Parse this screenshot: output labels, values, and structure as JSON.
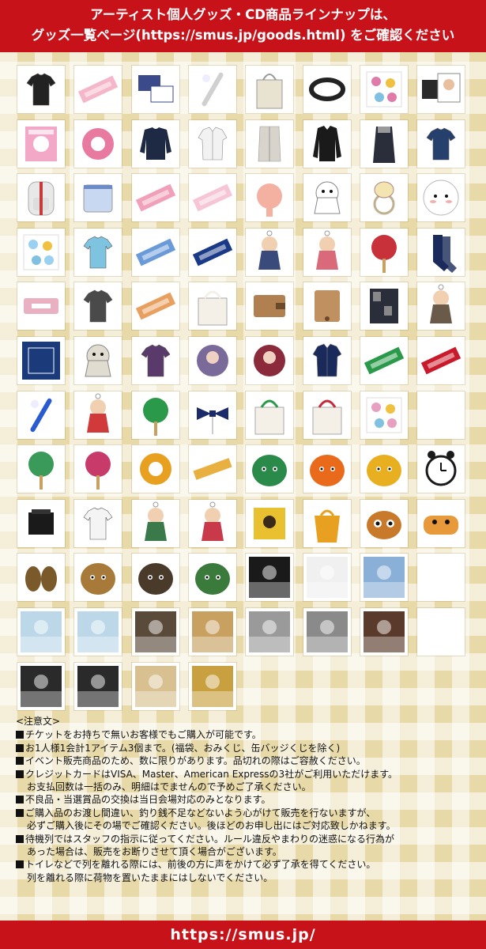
{
  "header": {
    "line1": "アーティスト個人グッズ・CD商品ラインナップは、",
    "line2": "グッズ一覧ページ(https://smus.jp/goods.html) をご確認ください"
  },
  "products": [
    {
      "icon": "tshirt",
      "color": "#222222"
    },
    {
      "icon": "towel",
      "color": "#f4b6c8"
    },
    {
      "icon": "cards",
      "color": "#3a4a8a"
    },
    {
      "icon": "penlight",
      "color": "#d0d0d0"
    },
    {
      "icon": "bag",
      "color": "#e8e2d0"
    },
    {
      "icon": "rubber-band",
      "color": "#222222"
    },
    {
      "icon": "stickers",
      "color": "#e07aa8"
    },
    {
      "icon": "card-set",
      "color": "#2a2a2a"
    },
    {
      "icon": "book",
      "color": "#f4a8c8"
    },
    {
      "icon": "tape",
      "color": "#e87aa0"
    },
    {
      "icon": "sweater",
      "color": "#1e2a44"
    },
    {
      "icon": "shirt",
      "color": "#f2f2f2"
    },
    {
      "icon": "cardigan",
      "color": "#d8d4cc"
    },
    {
      "icon": "jacket",
      "color": "#1a1a1a"
    },
    {
      "icon": "coat",
      "color": "#2a2d3a"
    },
    {
      "icon": "tshirt",
      "color": "#26406e"
    },
    {
      "icon": "backpack",
      "color": "#e8e8e8"
    },
    {
      "icon": "pouch",
      "color": "#c8d8f0"
    },
    {
      "icon": "towel",
      "color": "#f0a0b8"
    },
    {
      "icon": "towel",
      "color": "#f6c6d6"
    },
    {
      "icon": "mirror",
      "color": "#f4b0a0"
    },
    {
      "icon": "mascot",
      "color": "#ffffff"
    },
    {
      "icon": "hair-tie",
      "color": "#c0b090"
    },
    {
      "icon": "cushion",
      "color": "#ffffff"
    },
    {
      "icon": "stickers",
      "color": "#9ad0f0"
    },
    {
      "icon": "tshirt",
      "color": "#7ec4e0"
    },
    {
      "icon": "towel",
      "color": "#6a9ad8"
    },
    {
      "icon": "towel",
      "color": "#1a3a88"
    },
    {
      "icon": "acrylic",
      "color": "#3a4a7a"
    },
    {
      "icon": "acrylic",
      "color": "#d86a7a"
    },
    {
      "icon": "fan",
      "color": "#c8303a"
    },
    {
      "icon": "socks",
      "color": "#1a2a5a"
    },
    {
      "icon": "case",
      "color": "#e8b0c0"
    },
    {
      "icon": "tshirt",
      "color": "#4a4a4a"
    },
    {
      "icon": "towel",
      "color": "#e8a060"
    },
    {
      "icon": "tote",
      "color": "#f4f0e8"
    },
    {
      "icon": "wallet",
      "color": "#b08050"
    },
    {
      "icon": "card-case",
      "color": "#c09060"
    },
    {
      "icon": "notebook",
      "color": "#2a2e3a"
    },
    {
      "icon": "acrylic",
      "color": "#6a5a4a"
    },
    {
      "icon": "bandana",
      "color": "#1a3a7a"
    },
    {
      "icon": "mascot",
      "color": "#e0dcd0"
    },
    {
      "icon": "tshirt",
      "color": "#5a3a6a"
    },
    {
      "icon": "badge",
      "color": "#7a6a9a"
    },
    {
      "icon": "badge",
      "color": "#8a2a3a"
    },
    {
      "icon": "shirt",
      "color": "#1a2a5a"
    },
    {
      "icon": "towel",
      "color": "#2a9a4a"
    },
    {
      "icon": "towel",
      "color": "#c81a2a"
    },
    {
      "icon": "penlight",
      "color": "#2a5ad0"
    },
    {
      "icon": "acrylic",
      "color": "#d03a3a"
    },
    {
      "icon": "fan",
      "color": "#2a9a4a"
    },
    {
      "icon": "ribbon",
      "color": "#1a2a6a"
    },
    {
      "icon": "tote",
      "color": "#2a9a4a"
    },
    {
      "icon": "tote",
      "color": "#c82a3a"
    },
    {
      "icon": "stickers",
      "color": "#e8a0c0"
    },
    {
      "icon": "blank",
      "color": "#ffffff"
    },
    {
      "icon": "fan",
      "color": "#3a9a5a"
    },
    {
      "icon": "fan",
      "color": "#c83a6a"
    },
    {
      "icon": "tape",
      "color": "#e8a020"
    },
    {
      "icon": "ruler",
      "color": "#e8b040"
    },
    {
      "icon": "plush",
      "color": "#2a8a4a"
    },
    {
      "icon": "plush",
      "color": "#e86a1a"
    },
    {
      "icon": "plush",
      "color": "#e8b020"
    },
    {
      "icon": "clock",
      "color": "#1a1a1a"
    },
    {
      "icon": "box",
      "color": "#1a1a1a"
    },
    {
      "icon": "tshirt",
      "color": "#f4f4f4"
    },
    {
      "icon": "acrylic",
      "color": "#3a7a4a"
    },
    {
      "icon": "acrylic",
      "color": "#c83a4a"
    },
    {
      "icon": "blanket",
      "color": "#e8c030"
    },
    {
      "icon": "eco-bag",
      "color": "#e8a020"
    },
    {
      "icon": "mask",
      "color": "#c87a2a"
    },
    {
      "icon": "pen-case",
      "color": "#e89a3a"
    },
    {
      "icon": "slippers",
      "color": "#7a5a2a"
    },
    {
      "icon": "plush",
      "color": "#a87a3a"
    },
    {
      "icon": "plush",
      "color": "#4a3a2a"
    },
    {
      "icon": "plush",
      "color": "#3a7a3a"
    },
    {
      "icon": "cd",
      "color": "#1a1a1a"
    },
    {
      "icon": "cd",
      "color": "#f0f0f0"
    },
    {
      "icon": "cd",
      "color": "#8ab0d8"
    },
    {
      "icon": "blank",
      "color": "#ffffff"
    },
    {
      "icon": "cd",
      "color": "#bcd8e8"
    },
    {
      "icon": "cd",
      "color": "#bcd8e8"
    },
    {
      "icon": "cd",
      "color": "#5a4a3a"
    },
    {
      "icon": "cd",
      "color": "#c8a060"
    },
    {
      "icon": "cd",
      "color": "#9a9a9a"
    },
    {
      "icon": "cd",
      "color": "#8a8a8a"
    },
    {
      "icon": "cd",
      "color": "#5a3a2a"
    },
    {
      "icon": "blank",
      "color": "#ffffff"
    },
    {
      "icon": "cd",
      "color": "#2a2a2a"
    },
    {
      "icon": "cd",
      "color": "#2a2a2a"
    },
    {
      "icon": "cd",
      "color": "#d8c090"
    },
    {
      "icon": "cd",
      "color": "#c8a040"
    }
  ],
  "notice": {
    "title": "<注意文>",
    "items": [
      {
        "text": "チケットをお持ちで無いお客様でもご購入が可能です。",
        "cont": ""
      },
      {
        "text": "お1人様1会計1アイテム3個まで。(福袋、おみくじ、缶バッジくじを除く)",
        "cont": ""
      },
      {
        "text": "イベント販売商品のため、数に限りがあります。品切れの際はご容赦ください。",
        "cont": ""
      },
      {
        "text": "クレジットカードはVISA、Master、American Expressの3社がご利用いただけます。",
        "cont": "お支払回数は一括のみ、明細はでませんので予めご了承ください。"
      },
      {
        "text": "不良品・当選賞品の交換は当日会場対応のみとなります。",
        "cont": ""
      },
      {
        "text": "ご購入品のお渡し間違い、釣り銭不足などないよう心がけて販売を行ないますが、",
        "cont": "必ずご購入後にその場でご確認ください。後ほどのお申し出にはご対応致しかねます。"
      },
      {
        "text": "待機列ではスタッフの指示に従ってください。ルール違反やまわりの迷惑になる行為が",
        "cont": "あった場合は、販売をお断りさせて頂く場合がございます。"
      },
      {
        "text": "トイレなどで列を離れる際には、前後の方に声をかけて必ず了承を得てください。",
        "cont": "列を離れる際に荷物を置いたままにはしないでください。"
      }
    ]
  },
  "footer": {
    "url": "https://smus.jp/"
  },
  "colors": {
    "brand_red": "#c8121a",
    "gold_check": "#e8d9a8"
  }
}
